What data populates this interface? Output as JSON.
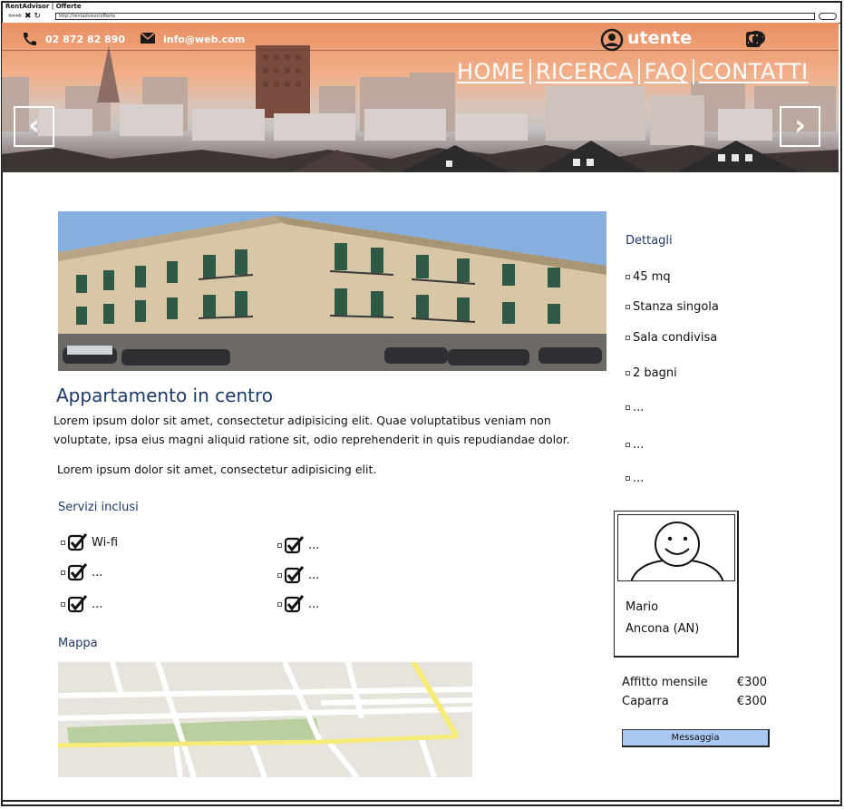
{
  "browser": {
    "title": "RentAdvisor | Offerte",
    "nav_buttons": "⇦⇨ ✖ ↻",
    "url": "http://rentadvisor/offerte"
  },
  "header": {
    "phone": "02 872 82 890",
    "email": "info@web.com",
    "user": "utente",
    "nav": [
      "HOME",
      "RICERCA",
      "FAQ",
      "CONTATTI"
    ],
    "prev_arrow": "‹",
    "next_arrow": "›",
    "icons": [
      "phone-icon",
      "envelope-icon",
      "user-icon",
      "chat-icon",
      "edit-icon",
      "logout-icon"
    ]
  },
  "listing": {
    "title": "Appartamento in centro",
    "paragraph1": "Lorem ipsum dolor sit amet, consectetur adipisicing elit. Quae voluptatibus veniam non voluptate, ipsa eius magni aliquid ratione sit, odio reprehenderit in quis repudiandae dolor.",
    "paragraph2": "Lorem ipsum dolor sit amet, consectetur adipisicing elit.",
    "services_label": "Servizi inclusi",
    "services": [
      "Wi-fi",
      "...",
      "...",
      "...",
      "...",
      "..."
    ],
    "map_label": "Mappa"
  },
  "details": {
    "label": "Dettagli",
    "items": [
      "45 mq",
      "Stanza singola",
      "Sala condivisa",
      "2 bagni",
      "...",
      "...",
      "..."
    ]
  },
  "owner": {
    "name": "Mario",
    "city": "Ancona (AN)"
  },
  "pricing": {
    "rent_label": "Affitto mensile",
    "rent_value": "€300",
    "deposit_label": "Caparra",
    "deposit_value": "€300"
  },
  "actions": {
    "message_label": "Messaggia"
  },
  "colors": {
    "heading_blue": "#1e3a6b",
    "button_blue": "#a9c7f1",
    "hero_orange": "#e98f63"
  }
}
